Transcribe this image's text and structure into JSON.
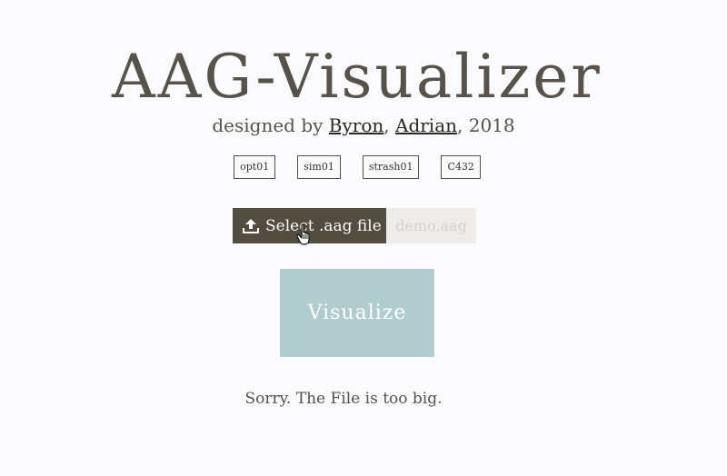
{
  "header": {
    "title": "AAG-Visualizer",
    "subtitle_prefix": "designed by ",
    "author1": "Byron",
    "separator": ", ",
    "author2": "Adrian",
    "year_suffix": ", 2018"
  },
  "examples": [
    "opt01",
    "sim01",
    "strash01",
    "C432"
  ],
  "upload": {
    "select_label": "Select .aag file",
    "file_name": "demo.aag",
    "icon": "upload-icon"
  },
  "visualize_label": "Visualize",
  "status_message": "Sorry. The File is too big.",
  "colors": {
    "accent_dark": "#534c41",
    "visualize_bg": "#b0cccd",
    "file_bg": "#eeeceb",
    "text": "#57534a"
  }
}
